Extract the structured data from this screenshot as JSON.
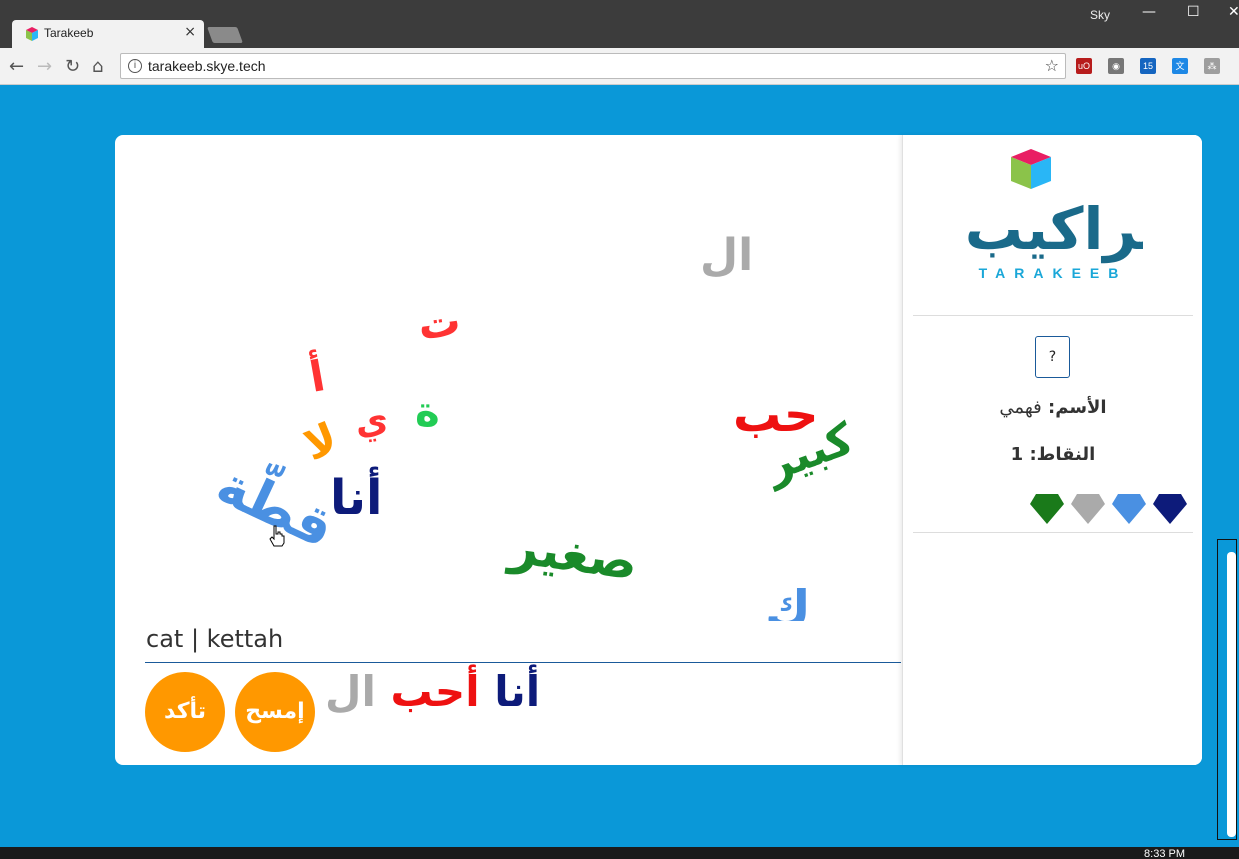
{
  "browser": {
    "tab_title": "Tarakeeb",
    "tab_close": "×",
    "user": "Sky",
    "minimize": "—",
    "maximize": "☐",
    "close": "✕",
    "back": "←",
    "forward": "→",
    "reload": "↻",
    "home": "⌂",
    "info": "i",
    "url": "tarakeeb.skye.tech",
    "bookmark_star": "☆",
    "extensions": [
      {
        "name": "ublock-icon",
        "color": "#b71c1c",
        "label": "uO"
      },
      {
        "name": "camera-icon",
        "color": "#777777",
        "label": "◉"
      },
      {
        "name": "calendar-icon",
        "color": "#1565c0",
        "label": "15"
      },
      {
        "name": "translate-icon",
        "color": "#1e88e5",
        "label": "文"
      },
      {
        "name": "extension-icon",
        "color": "#9e9e9e",
        "label": "⁂"
      }
    ]
  },
  "game": {
    "floating_words": [
      {
        "text": "ال",
        "color": "#aaaaaa"
      },
      {
        "text": "ت",
        "color": "#ff3333"
      },
      {
        "text": "أ",
        "color": "#ff3333"
      },
      {
        "text": "ي",
        "color": "#ff3333"
      },
      {
        "text": "ة",
        "color": "#22cc55"
      },
      {
        "text": "لا",
        "color": "#ff9800"
      },
      {
        "text": "أنا",
        "color": "#0d1b7a"
      },
      {
        "text": "قطّة",
        "color": "#4a90e2"
      },
      {
        "text": "حب",
        "color": "#ee1111"
      },
      {
        "text": "كبير",
        "color": "#1a8a2a"
      },
      {
        "text": "صغير",
        "color": "#1a8a2a"
      },
      {
        "text": "ك",
        "color": "#4a90e2"
      }
    ],
    "translation": "cat | kettah",
    "confirm_button": "تأكد",
    "clear_button": "إمسح",
    "sentence": [
      {
        "text": "أنا",
        "color": "#0d1b7a"
      },
      {
        "text": "أ",
        "color": "#ee1111"
      },
      {
        "text": "حب",
        "color": "#ee1111"
      },
      {
        "text": "ال",
        "color": "#aaaaaa"
      }
    ]
  },
  "sidebar": {
    "logo_latin": "TARAKEEB",
    "logo_arabic": "تراكيب",
    "help": "?",
    "name_label": "الأسم:",
    "name_value": "فهمي",
    "points_label": "النقاط:",
    "points_value": "1",
    "gems": [
      {
        "name": "gem-navy-icon",
        "color": "#0d1b7a"
      },
      {
        "name": "gem-blue-icon",
        "color": "#4a90e2"
      },
      {
        "name": "gem-gray-icon",
        "color": "#aaaaaa"
      },
      {
        "name": "gem-green-icon",
        "color": "#1a7a1a"
      }
    ]
  },
  "taskbar": {
    "clock": "8:33 PM"
  }
}
